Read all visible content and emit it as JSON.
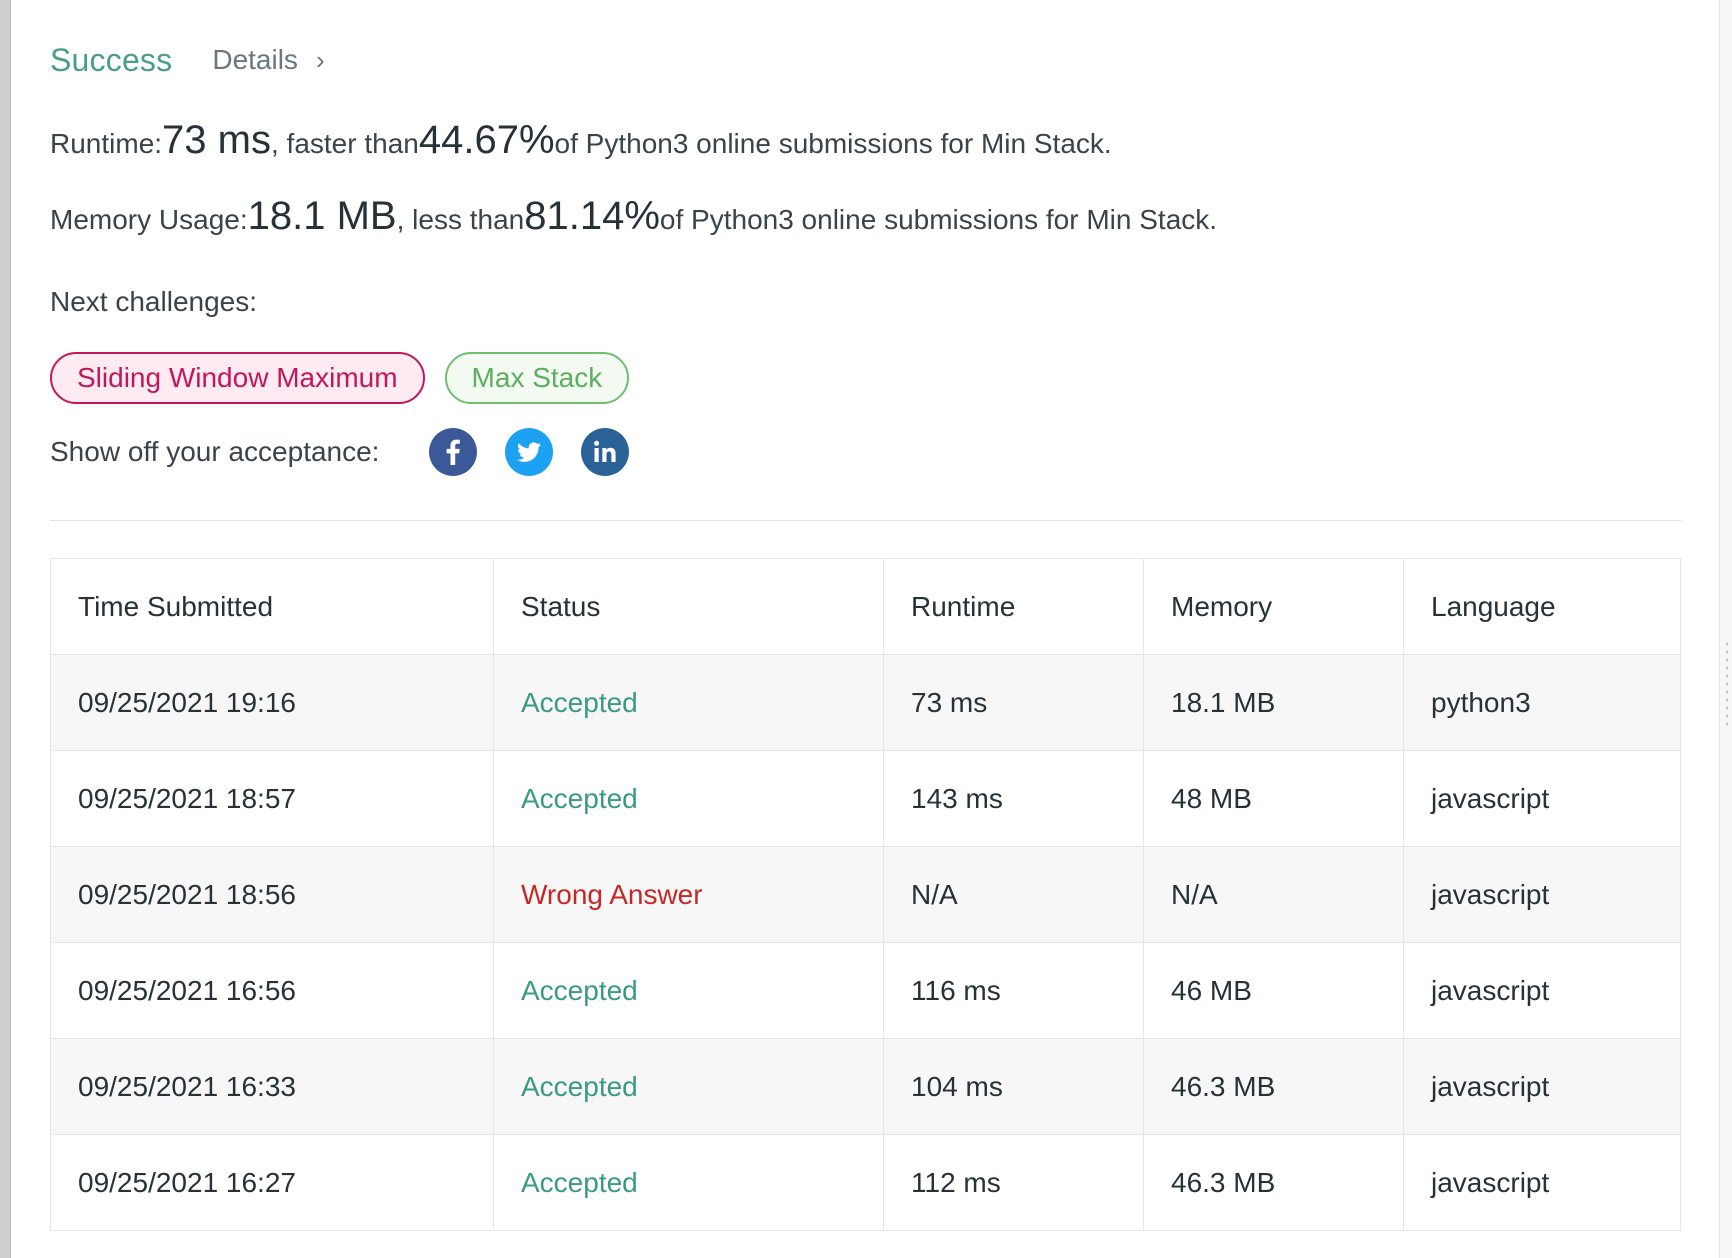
{
  "header": {
    "status": "Success",
    "details_label": "Details",
    "details_chevron": "›"
  },
  "runtime": {
    "label": "Runtime: ",
    "value": "73 ms",
    "middle": ", faster than ",
    "percent": "44.67%",
    "suffix": " of Python3 online submissions for Min Stack."
  },
  "memory": {
    "label": "Memory Usage: ",
    "value": "18.1 MB",
    "middle": ", less than ",
    "percent": "81.14%",
    "suffix": " of Python3 online submissions for Min Stack."
  },
  "next": {
    "label": "Next challenges:",
    "challenges": [
      {
        "title": "Sliding Window Maximum",
        "difficulty_color": "#c2185b"
      },
      {
        "title": "Max Stack",
        "difficulty_color": "#5caf60"
      }
    ]
  },
  "share": {
    "label": "Show off your acceptance:",
    "icons": [
      "facebook-icon",
      "twitter-icon",
      "linkedin-icon"
    ]
  },
  "table": {
    "headers": [
      "Time Submitted",
      "Status",
      "Runtime",
      "Memory",
      "Language"
    ],
    "rows": [
      {
        "time": "09/25/2021 19:16",
        "status": "Accepted",
        "runtime": "73 ms",
        "memory": "18.1 MB",
        "language": "python3"
      },
      {
        "time": "09/25/2021 18:57",
        "status": "Accepted",
        "runtime": "143 ms",
        "memory": "48 MB",
        "language": "javascript"
      },
      {
        "time": "09/25/2021 18:56",
        "status": "Wrong Answer",
        "runtime": "N/A",
        "memory": "N/A",
        "language": "javascript"
      },
      {
        "time": "09/25/2021 16:56",
        "status": "Accepted",
        "runtime": "116 ms",
        "memory": "46 MB",
        "language": "javascript"
      },
      {
        "time": "09/25/2021 16:33",
        "status": "Accepted",
        "runtime": "104 ms",
        "memory": "46.3 MB",
        "language": "javascript"
      },
      {
        "time": "09/25/2021 16:27",
        "status": "Accepted",
        "runtime": "112 ms",
        "memory": "46.3 MB",
        "language": "javascript"
      }
    ]
  },
  "colors": {
    "success": "#4a9e88",
    "accepted": "#3a9a82",
    "wrong_answer": "#c62828",
    "facebook": "#3b5998",
    "twitter": "#1da1f2",
    "linkedin": "#2a6196"
  }
}
